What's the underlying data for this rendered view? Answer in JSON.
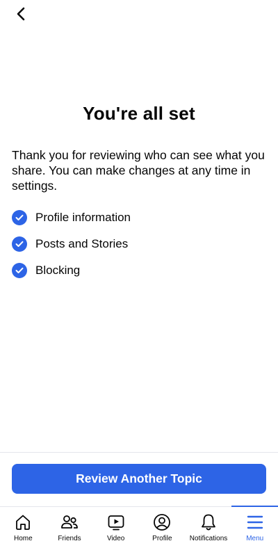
{
  "header": {
    "back_icon": "chevron-left-icon"
  },
  "main": {
    "title": "You're all set",
    "description": "Thank you for reviewing who can see what you share. You can make changes at any time in settings.",
    "checklist": [
      {
        "label": "Profile information",
        "icon": "check-circle-icon"
      },
      {
        "label": "Posts and Stories",
        "icon": "check-circle-icon"
      },
      {
        "label": "Blocking",
        "icon": "check-circle-icon"
      }
    ]
  },
  "footer": {
    "primary_button": "Review Another Topic"
  },
  "tabbar": {
    "items": [
      {
        "label": "Home",
        "icon": "home-icon"
      },
      {
        "label": "Friends",
        "icon": "friends-icon"
      },
      {
        "label": "Video",
        "icon": "video-icon"
      },
      {
        "label": "Profile",
        "icon": "profile-icon"
      },
      {
        "label": "Notifications",
        "icon": "bell-icon"
      },
      {
        "label": "Menu",
        "icon": "menu-icon",
        "active": true
      }
    ]
  },
  "colors": {
    "accent": "#2d64e6",
    "text": "#050505",
    "divider": "#e4e6eb"
  }
}
